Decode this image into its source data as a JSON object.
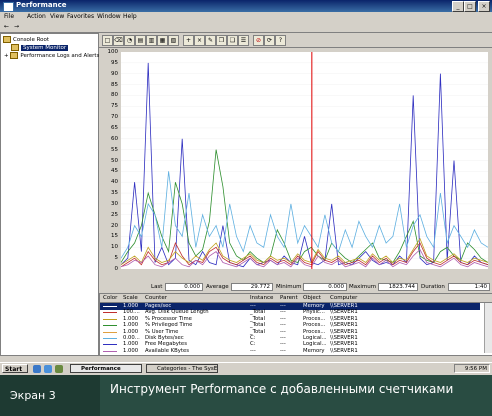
{
  "window": {
    "title": "Performance",
    "controls": [
      "_",
      "□",
      "×"
    ]
  },
  "menu": [
    "File",
    "Action",
    "View",
    "Favorites",
    "Window",
    "Help"
  ],
  "nav": {
    "back": "←",
    "forward": "→"
  },
  "tree": {
    "items": [
      {
        "label": "Console Root"
      },
      {
        "label": "System Monitor",
        "selected": true
      },
      {
        "label": "Performance Logs and Alerts"
      }
    ]
  },
  "toolbar_icons": [
    "new-icon",
    "clear-icon",
    "current-activity-icon",
    "view-log-icon",
    "view-graph-icon",
    "view-histogram-icon",
    "view-report-icon",
    "add-icon",
    "delete-icon",
    "highlight-icon",
    "copy-icon",
    "paste-icon",
    "properties-icon",
    "freeze-icon",
    "update-icon",
    "help-icon"
  ],
  "chart_data": {
    "type": "line",
    "ylim": [
      0,
      100
    ],
    "y_ticks": [
      "100",
      "95",
      "90",
      "85",
      "80",
      "75",
      "70",
      "65",
      "60",
      "55",
      "50",
      "45",
      "40",
      "35",
      "30",
      "25",
      "20",
      "15",
      "10",
      "5",
      "0"
    ],
    "vertical_marker_x": 0.52,
    "series": [
      {
        "color": "#3030c0",
        "values": [
          2,
          5,
          40,
          8,
          95,
          3,
          10,
          2,
          5,
          60,
          4,
          2,
          8,
          3,
          2,
          20,
          3,
          2,
          1,
          5,
          2,
          3,
          4,
          2,
          6,
          3,
          2,
          15,
          3,
          2,
          4,
          30,
          2,
          3,
          2,
          5,
          8,
          4,
          2,
          3,
          2,
          6,
          3,
          80,
          5,
          2,
          3,
          90,
          4,
          50,
          3,
          2,
          6,
          3,
          2
        ]
      },
      {
        "color": "#309030",
        "values": [
          3,
          8,
          12,
          20,
          35,
          25,
          15,
          8,
          40,
          30,
          12,
          6,
          9,
          22,
          55,
          38,
          12,
          6,
          4,
          8,
          5,
          3,
          6,
          18,
          12,
          4,
          3,
          8,
          10,
          6,
          4,
          12,
          8,
          5,
          3,
          6,
          9,
          12,
          5,
          4,
          3,
          8,
          15,
          22,
          6,
          4,
          3,
          8,
          10,
          6,
          4,
          12,
          9,
          5,
          3
        ]
      },
      {
        "color": "#c03030",
        "values": [
          1,
          3,
          5,
          2,
          8,
          4,
          2,
          3,
          12,
          6,
          2,
          4,
          3,
          8,
          10,
          5,
          3,
          2,
          4,
          6,
          3,
          2,
          5,
          3,
          4,
          2,
          6,
          3,
          2,
          8,
          4,
          3,
          5,
          2,
          3,
          4,
          2,
          6,
          3,
          5,
          2,
          4,
          3,
          8,
          12,
          5,
          3,
          2,
          4,
          6,
          3,
          2,
          4,
          3,
          2
        ]
      },
      {
        "color": "#c0a020",
        "values": [
          2,
          4,
          6,
          3,
          10,
          5,
          3,
          4,
          8,
          5,
          3,
          6,
          4,
          9,
          12,
          6,
          4,
          3,
          5,
          7,
          4,
          3,
          6,
          4,
          5,
          3,
          7,
          4,
          3,
          9,
          5,
          4,
          6,
          3,
          4,
          5,
          3,
          7,
          4,
          6,
          3,
          5,
          4,
          9,
          14,
          6,
          4,
          3,
          5,
          7,
          4,
          3,
          5,
          4,
          3
        ]
      },
      {
        "color": "#60b0e0",
        "values": [
          5,
          10,
          20,
          15,
          30,
          25,
          10,
          45,
          20,
          15,
          35,
          10,
          25,
          15,
          20,
          10,
          30,
          15,
          8,
          20,
          12,
          10,
          25,
          15,
          10,
          30,
          12,
          20,
          15,
          10,
          25,
          12,
          8,
          18,
          10,
          22,
          15,
          10,
          20,
          12,
          15,
          30,
          10,
          20,
          25,
          15,
          10,
          35,
          12,
          20,
          15,
          10,
          18,
          12,
          10
        ]
      },
      {
        "color": "#b060b0",
        "values": [
          1,
          2,
          4,
          3,
          6,
          2,
          1,
          3,
          5,
          2,
          1,
          4,
          2,
          6,
          8,
          3,
          2,
          1,
          3,
          5,
          2,
          1,
          4,
          2,
          3,
          1,
          5,
          2,
          1,
          6,
          3,
          2,
          4,
          1,
          2,
          3,
          1,
          5,
          2,
          4,
          1,
          3,
          2,
          6,
          9,
          3,
          2,
          1,
          3,
          5,
          2,
          1,
          3,
          2,
          1
        ]
      }
    ]
  },
  "stats": {
    "last_label": "Last",
    "last_value": "0.000",
    "avg_label": "Average",
    "avg_value": "29.772",
    "min_label": "Minimum",
    "min_value": "0.000",
    "max_label": "Maximum",
    "max_value": "1823.744",
    "duration_label": "Duration",
    "duration_value": "1:40"
  },
  "counters": {
    "headers": [
      "Color",
      "Scale",
      "Counter",
      "Instance",
      "Parent",
      "Object",
      "Computer"
    ],
    "rows": [
      {
        "color": "#000000",
        "scale": "1.000",
        "counter": "Pages/sec",
        "instance": "---",
        "parent": "---",
        "object": "Memory",
        "computer": "\\\\SERVER1",
        "selected": true
      },
      {
        "color": "#c03030",
        "scale": "100....",
        "counter": "Avg. Disk Queue Length",
        "instance": "_Total",
        "parent": "---",
        "object": "Physic...",
        "computer": "\\\\SERVER1"
      },
      {
        "color": "#c0a020",
        "scale": "1.000",
        "counter": "% Processor Time",
        "instance": "_Total",
        "parent": "---",
        "object": "Proces...",
        "computer": "\\\\SERVER1"
      },
      {
        "color": "#309030",
        "scale": "1.000",
        "counter": "% Privileged Time",
        "instance": "_Total",
        "parent": "---",
        "object": "Proces...",
        "computer": "\\\\SERVER1"
      },
      {
        "color": "#e0a040",
        "scale": "1.000",
        "counter": "% User Time",
        "instance": "_Total",
        "parent": "---",
        "object": "Proces...",
        "computer": "\\\\SERVER1"
      },
      {
        "color": "#60b0e0",
        "scale": "0.00...",
        "counter": "Disk Bytes/sec",
        "instance": "C:",
        "parent": "---",
        "object": "Logical...",
        "computer": "\\\\SERVER1"
      },
      {
        "color": "#3030c0",
        "scale": "1.000",
        "counter": "Free Megabytes",
        "instance": "C:",
        "parent": "---",
        "object": "Logical...",
        "computer": "\\\\SERVER1"
      },
      {
        "color": "#b060b0",
        "scale": "1.000",
        "counter": "Available KBytes",
        "instance": "---",
        "parent": "---",
        "object": "Memory",
        "computer": "\\\\SERVER1"
      }
    ]
  },
  "taskbar": {
    "start_label": "Start",
    "buttons": [
      {
        "label": "Performance",
        "active": true
      },
      {
        "label": "Categories - The SysEdC..."
      }
    ],
    "clock": "9:56 PM"
  },
  "caption": {
    "label": "Экран 3",
    "text": "Инструмент Performance с добавленными счетчиками"
  }
}
